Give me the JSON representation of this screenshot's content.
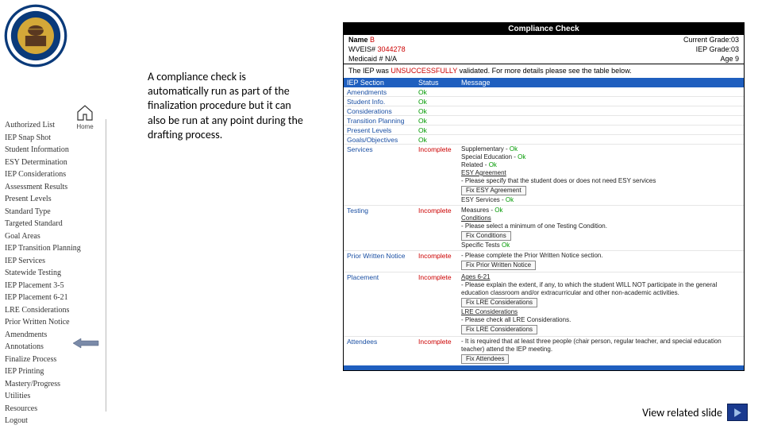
{
  "home_label": "Home",
  "sidebar": {
    "items": [
      "Authorized List",
      "IEP Snap Shot",
      "Student Information",
      "ESY Determination",
      "IEP Considerations",
      "Assessment Results",
      "Present Levels",
      "Standard Type",
      "Targeted Standard",
      "Goal Areas",
      "IEP Transition Planning",
      "IEP Services",
      "Statewide Testing",
      "IEP Placement 3-5",
      "IEP Placement 6-21",
      "LRE Considerations",
      "Prior Written Notice",
      "Amendments",
      "Annotations",
      "Finalize Process",
      "IEP Printing",
      "Mastery/Progress",
      "Utilities",
      "Resources",
      "Logout"
    ]
  },
  "callout": "A compliance check is automatically run as part of the finalization procedure but it can also be run at any point during the drafting process.",
  "panel": {
    "title": "Compliance Check",
    "name_label": "Name",
    "name_val": "B",
    "grade_label": "Current Grade:",
    "grade_val": "03",
    "wveis_label": "WVEIS#",
    "wveis_val": "3044278",
    "iepgrade_label": "IEP Grade:",
    "iepgrade_val": "03",
    "medicaid_label": "Medicaid # ",
    "medicaid_val": "N/A",
    "age_label": "Age ",
    "age_val": "9",
    "result_pre": "The IEP was ",
    "result_status": "UNSUCCESSFULLY",
    "result_post": " validated. For more details please see the table below.",
    "th_section": "IEP Section",
    "th_status": "Status",
    "th_message": "Message",
    "rows": {
      "r1": {
        "sec": "Amendments",
        "stat": "Ok"
      },
      "r2": {
        "sec": "Student Info.",
        "stat": "Ok"
      },
      "r3": {
        "sec": "Considerations",
        "stat": "Ok"
      },
      "r4": {
        "sec": "Transition Planning",
        "stat": "Ok"
      },
      "r5": {
        "sec": "Present Levels",
        "stat": "Ok"
      },
      "r6": {
        "sec": "Goals/Objectives",
        "stat": "Ok"
      },
      "r7": {
        "sec": "Services",
        "stat": "Incomplete",
        "m1a": "Supplementary - ",
        "m1b": "Ok",
        "m2a": "Special Education - ",
        "m2b": "Ok",
        "m3a": "Related - ",
        "m3b": "Ok",
        "m4a": "ESY Agreement",
        "m5": "- Please specify that the student does or does not need ESY services",
        "btn": "Fix ESY Agreement",
        "m6a": "ESY Services - ",
        "m6b": "Ok"
      },
      "r8": {
        "sec": "Testing",
        "stat": "Incomplete",
        "m1a": "Measures - ",
        "m1b": "Ok",
        "m2": "Conditions",
        "m3": "- Please select a minimum of one Testing Condition.",
        "btn": "Fix Conditions",
        "m4a": "Specific Tests ",
        "m4b": "Ok"
      },
      "r9": {
        "sec": "Prior Written Notice",
        "stat": "Incomplete",
        "m1": "- Please complete the Prior Written Notice section.",
        "btn": "Fix Prior Written Notice"
      },
      "r10": {
        "sec": "Placement",
        "stat": "Incomplete",
        "m1": "Ages 6-21",
        "m2": "- Please explain the extent, if any, to which the student WILL NOT participate in the general education classroom and/or extracurricular and other non-academic activities.",
        "btn1": "Fix LRE Considerations",
        "m3": "LRE Considerations",
        "m4": "- Please check all LRE Considerations.",
        "btn2": "Fix LRE Considerations"
      },
      "r11": {
        "sec": "Attendees",
        "stat": "Incomplete",
        "m1": "- It is required that at least three people (chair person, regular teacher, and special education teacher) attend the IEP meeting.",
        "btn": "Fix Attendees"
      }
    }
  },
  "view_label": "View related slide"
}
